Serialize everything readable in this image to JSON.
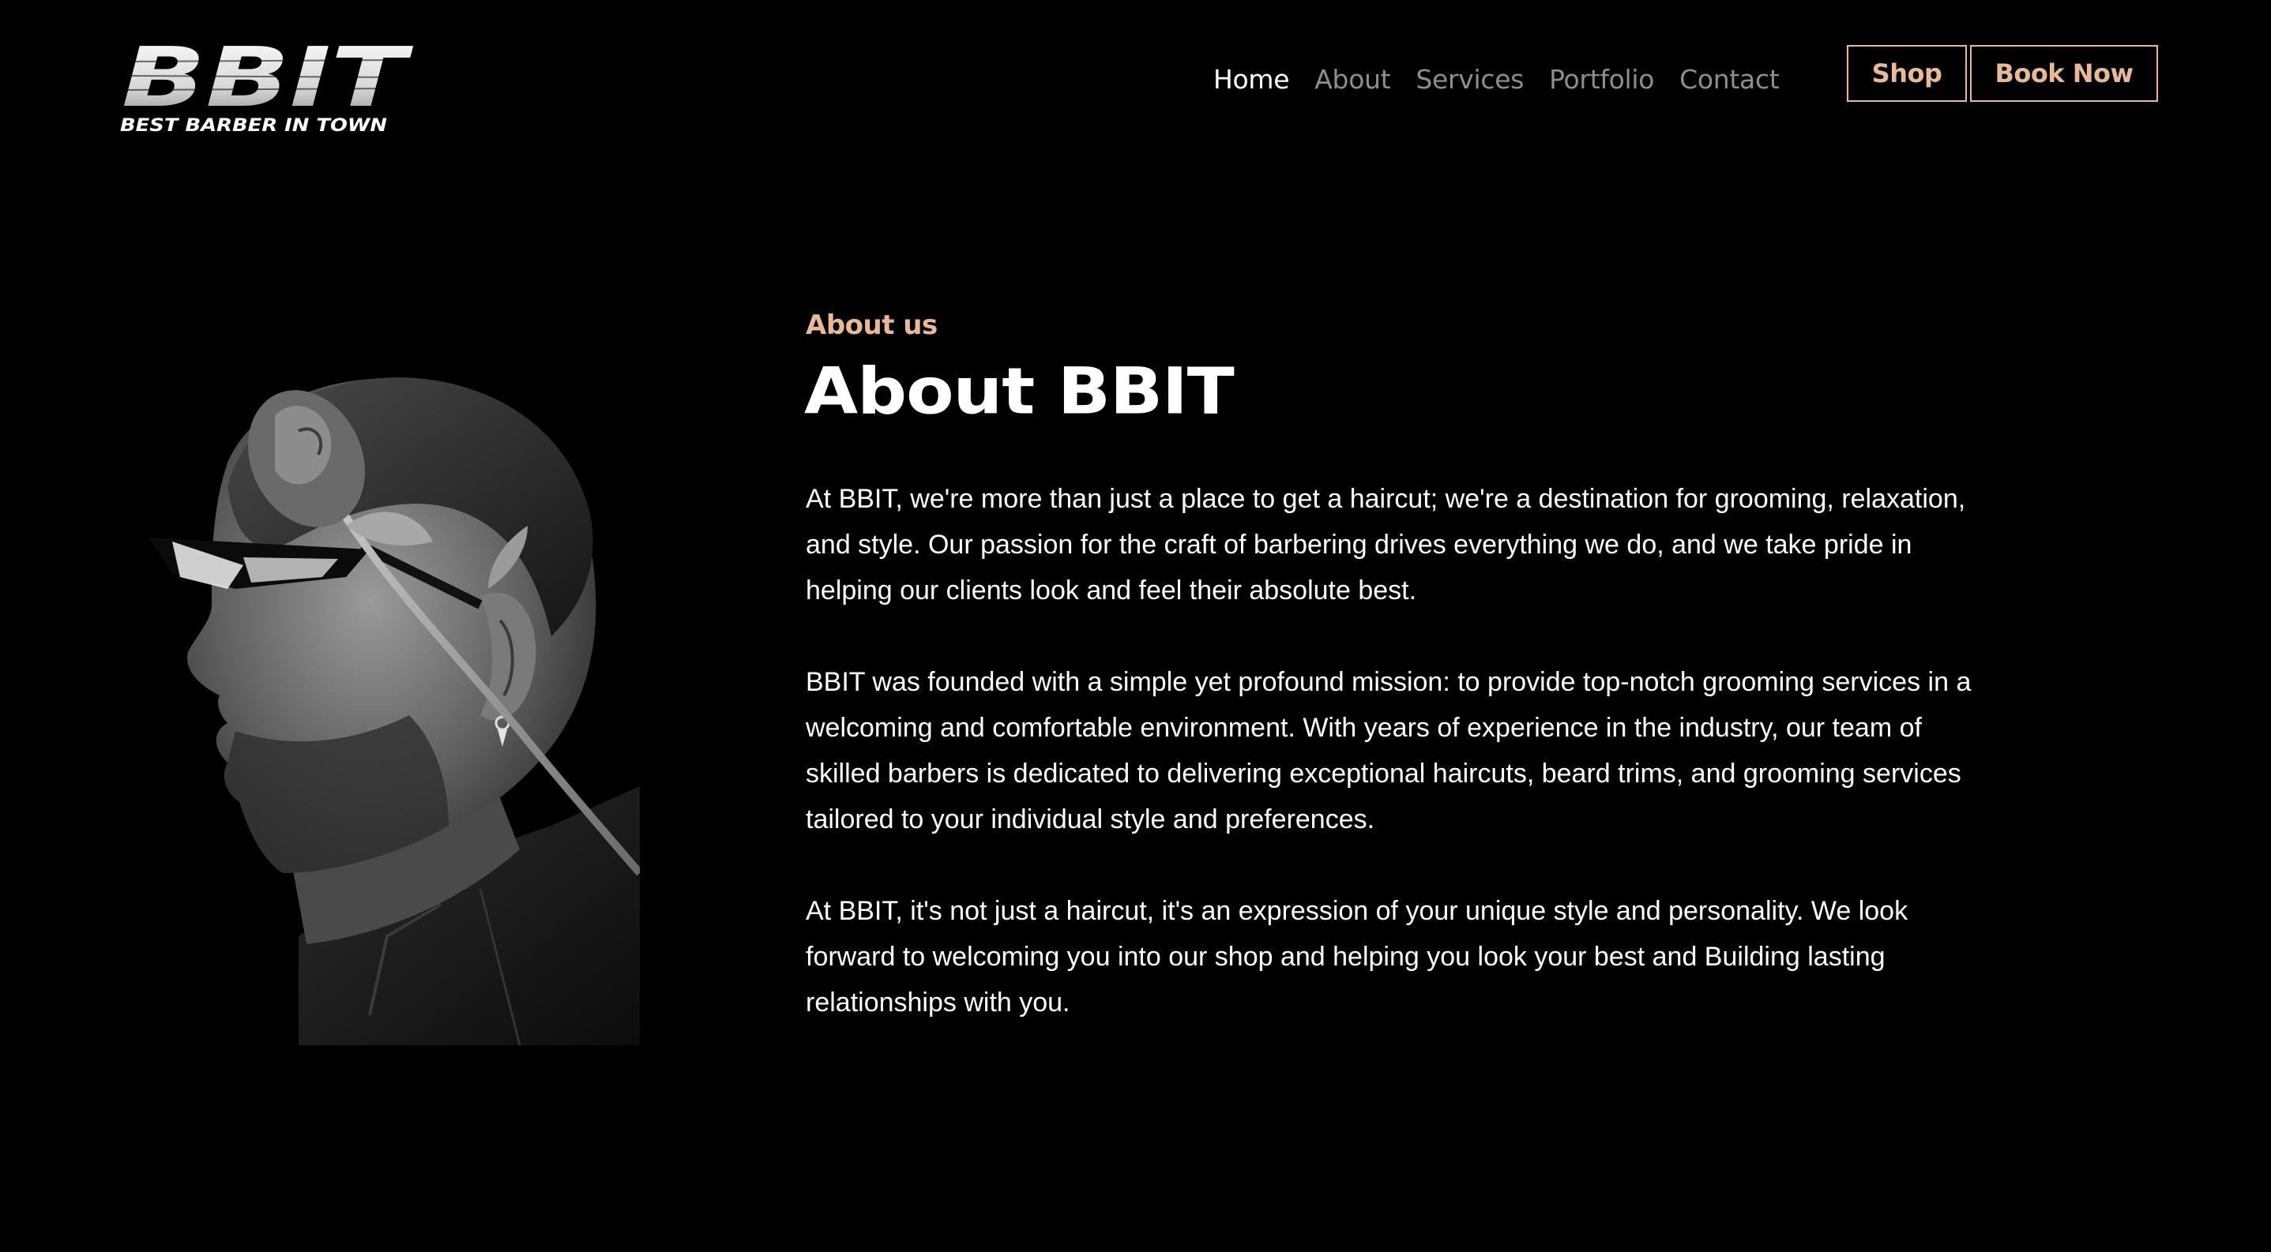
{
  "header": {
    "logo": {
      "wordmark": "BBIT",
      "tagline": "BEST BARBER IN TOWN"
    },
    "nav": [
      {
        "label": "Home",
        "active": true
      },
      {
        "label": "About",
        "active": false
      },
      {
        "label": "Services",
        "active": false
      },
      {
        "label": "Portfolio",
        "active": false
      },
      {
        "label": "Contact",
        "active": false
      }
    ],
    "shop_label": "Shop",
    "book_label": "Book Now"
  },
  "about": {
    "eyebrow": "About us",
    "title": "About BBIT",
    "paragraphs": [
      "At BBIT, we're more than just a place to get a haircut; we're a destination for grooming, relaxation, and style. Our passion for the craft of barbering drives everything we do, and we take pride in helping our clients look and feel their absolute best.",
      "BBIT was founded with a simple yet profound mission: to provide top-notch grooming services in a welcoming and comfortable environment. With years of experience in the industry, our team of skilled barbers is dedicated to delivering exceptional haircuts, beard trims, and grooming services tailored to your individual style and preferences.",
      "At BBIT, it's not just a haircut, it's an expression of your unique style and personality. We look forward to welcoming you into our shop and helping you look your best and Building lasting relationships with you."
    ]
  },
  "colors": {
    "background": "#000000",
    "accent": "#e8b998",
    "nav_inactive": "#8e8e8e",
    "text": "#ffffff"
  }
}
